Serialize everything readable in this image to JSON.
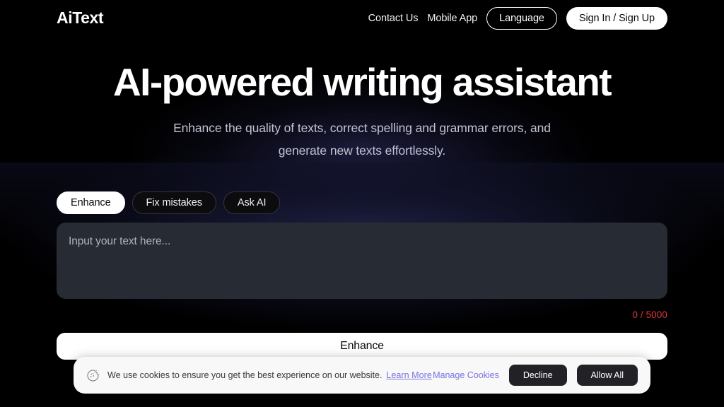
{
  "header": {
    "logo": "AiText",
    "nav_links": [
      {
        "label": "Contact Us"
      },
      {
        "label": "Mobile App"
      }
    ],
    "language_button": "Language",
    "auth_button": "Sign In / Sign Up"
  },
  "hero": {
    "title": "AI-powered writing assistant",
    "subtitle": "Enhance the quality of texts, correct spelling and grammar errors, and generate new texts effortlessly."
  },
  "tabs": [
    {
      "label": "Enhance",
      "active": true
    },
    {
      "label": "Fix mistakes",
      "active": false
    },
    {
      "label": "Ask AI",
      "active": false
    }
  ],
  "editor": {
    "placeholder": "Input your text here...",
    "value": "",
    "counter": "0 / 5000",
    "counter_color": "#e0333c"
  },
  "submit": {
    "label": "Enhance"
  },
  "cookie_banner": {
    "icon": "cookie-icon",
    "message": "We use cookies to ensure you get the best experience on our website.",
    "learn_more": "Learn More",
    "manage": "Manage Cookies",
    "decline": "Decline",
    "allow": "Allow All",
    "link_color": "#7b72e0"
  }
}
